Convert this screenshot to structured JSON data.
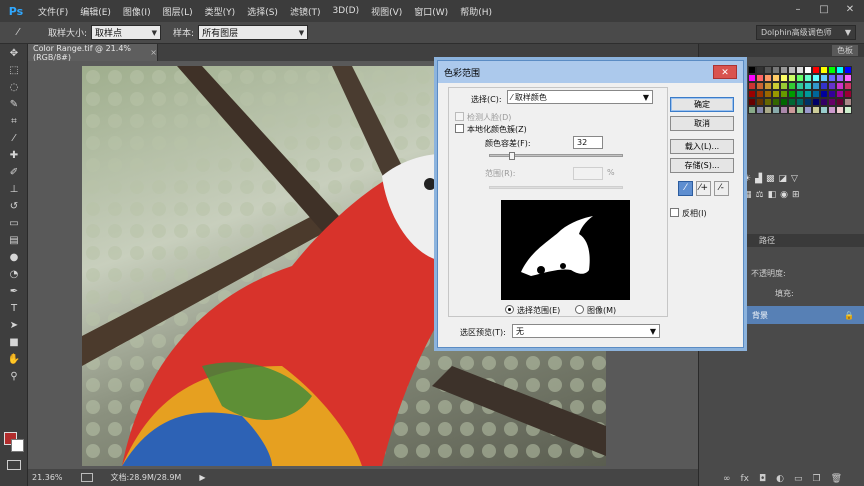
{
  "app": {
    "logo": "Ps"
  },
  "menubar": {
    "items": [
      "文件(F)",
      "编辑(E)",
      "图像(I)",
      "图层(L)",
      "类型(Y)",
      "选择(S)",
      "滤镜(T)",
      "3D(D)",
      "视图(V)",
      "窗口(W)",
      "帮助(H)"
    ],
    "window_controls": [
      "–",
      "□",
      "✕"
    ]
  },
  "options": {
    "sample_size_label": "取样大小:",
    "sample_size_value": "取样点",
    "sample_label": "样本:",
    "sample_value": "所有图层",
    "workspace": "Dolphin高级调色师"
  },
  "document": {
    "tab_title": "Color Range.tif @ 21.4%(RGB/8#)",
    "zoom": "21.36%",
    "doc_info": "文档:28.9M/28.9M"
  },
  "right_panel": {
    "tabs": [
      "色板"
    ],
    "layer_opacity_label": "不透明度:",
    "layer_fill_label": "填充:",
    "layer_name": "背景",
    "paths_tab": "路径"
  },
  "dialog": {
    "title": "色彩范围",
    "select_label": "选择(C):",
    "select_value": "取样颜色",
    "detect_faces": "检测人脸(D)",
    "localized": "本地化颜色簇(Z)",
    "fuzziness_label": "颜色容差(F):",
    "fuzziness_value": "32",
    "range_label": "范围(R):",
    "range_unit": "%",
    "radio_selection": "选择范围(E)",
    "radio_image": "图像(M)",
    "preview_label": "选区预览(T):",
    "preview_value": "无",
    "btn_ok": "确定",
    "btn_cancel": "取消",
    "btn_load": "载入(L)...",
    "btn_save": "存储(S)...",
    "invert": "反相(I)",
    "fuzziness_fraction": 0.17
  },
  "colors": {
    "foreground": "#b22d2d",
    "background": "#ffffff",
    "accent": "#5780b5"
  },
  "icons": {
    "tools": [
      "move-icon",
      "marquee-icon",
      "lasso-icon",
      "quick-select-icon",
      "crop-icon",
      "eyedropper-icon",
      "healing-icon",
      "brush-icon",
      "stamp-icon",
      "history-brush-icon",
      "eraser-icon",
      "gradient-icon",
      "blur-icon",
      "dodge-icon",
      "pen-icon",
      "type-icon",
      "path-select-icon",
      "shape-icon",
      "hand-icon",
      "zoom-icon"
    ]
  }
}
